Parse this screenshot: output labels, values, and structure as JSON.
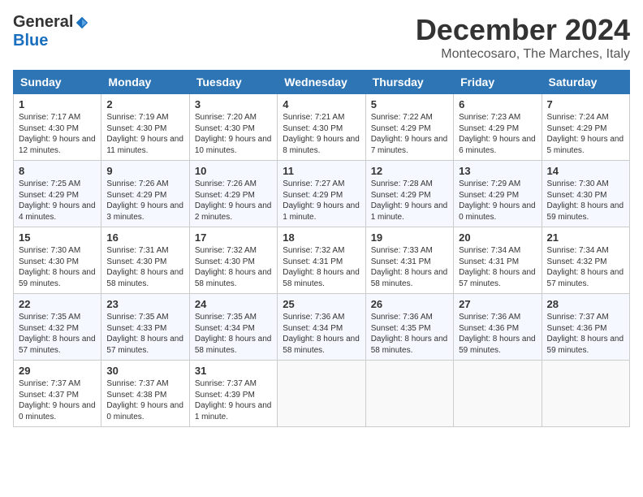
{
  "logo": {
    "general": "General",
    "blue": "Blue"
  },
  "title": "December 2024",
  "subtitle": "Montecosaro, The Marches, Italy",
  "days_of_week": [
    "Sunday",
    "Monday",
    "Tuesday",
    "Wednesday",
    "Thursday",
    "Friday",
    "Saturday"
  ],
  "weeks": [
    [
      {
        "day": "1",
        "info": "Sunrise: 7:17 AM\nSunset: 4:30 PM\nDaylight: 9 hours and 12 minutes."
      },
      {
        "day": "2",
        "info": "Sunrise: 7:19 AM\nSunset: 4:30 PM\nDaylight: 9 hours and 11 minutes."
      },
      {
        "day": "3",
        "info": "Sunrise: 7:20 AM\nSunset: 4:30 PM\nDaylight: 9 hours and 10 minutes."
      },
      {
        "day": "4",
        "info": "Sunrise: 7:21 AM\nSunset: 4:30 PM\nDaylight: 9 hours and 8 minutes."
      },
      {
        "day": "5",
        "info": "Sunrise: 7:22 AM\nSunset: 4:29 PM\nDaylight: 9 hours and 7 minutes."
      },
      {
        "day": "6",
        "info": "Sunrise: 7:23 AM\nSunset: 4:29 PM\nDaylight: 9 hours and 6 minutes."
      },
      {
        "day": "7",
        "info": "Sunrise: 7:24 AM\nSunset: 4:29 PM\nDaylight: 9 hours and 5 minutes."
      }
    ],
    [
      {
        "day": "8",
        "info": "Sunrise: 7:25 AM\nSunset: 4:29 PM\nDaylight: 9 hours and 4 minutes."
      },
      {
        "day": "9",
        "info": "Sunrise: 7:26 AM\nSunset: 4:29 PM\nDaylight: 9 hours and 3 minutes."
      },
      {
        "day": "10",
        "info": "Sunrise: 7:26 AM\nSunset: 4:29 PM\nDaylight: 9 hours and 2 minutes."
      },
      {
        "day": "11",
        "info": "Sunrise: 7:27 AM\nSunset: 4:29 PM\nDaylight: 9 hours and 1 minute."
      },
      {
        "day": "12",
        "info": "Sunrise: 7:28 AM\nSunset: 4:29 PM\nDaylight: 9 hours and 1 minute."
      },
      {
        "day": "13",
        "info": "Sunrise: 7:29 AM\nSunset: 4:29 PM\nDaylight: 9 hours and 0 minutes."
      },
      {
        "day": "14",
        "info": "Sunrise: 7:30 AM\nSunset: 4:30 PM\nDaylight: 8 hours and 59 minutes."
      }
    ],
    [
      {
        "day": "15",
        "info": "Sunrise: 7:30 AM\nSunset: 4:30 PM\nDaylight: 8 hours and 59 minutes."
      },
      {
        "day": "16",
        "info": "Sunrise: 7:31 AM\nSunset: 4:30 PM\nDaylight: 8 hours and 58 minutes."
      },
      {
        "day": "17",
        "info": "Sunrise: 7:32 AM\nSunset: 4:30 PM\nDaylight: 8 hours and 58 minutes."
      },
      {
        "day": "18",
        "info": "Sunrise: 7:32 AM\nSunset: 4:31 PM\nDaylight: 8 hours and 58 minutes."
      },
      {
        "day": "19",
        "info": "Sunrise: 7:33 AM\nSunset: 4:31 PM\nDaylight: 8 hours and 58 minutes."
      },
      {
        "day": "20",
        "info": "Sunrise: 7:34 AM\nSunset: 4:31 PM\nDaylight: 8 hours and 57 minutes."
      },
      {
        "day": "21",
        "info": "Sunrise: 7:34 AM\nSunset: 4:32 PM\nDaylight: 8 hours and 57 minutes."
      }
    ],
    [
      {
        "day": "22",
        "info": "Sunrise: 7:35 AM\nSunset: 4:32 PM\nDaylight: 8 hours and 57 minutes."
      },
      {
        "day": "23",
        "info": "Sunrise: 7:35 AM\nSunset: 4:33 PM\nDaylight: 8 hours and 57 minutes."
      },
      {
        "day": "24",
        "info": "Sunrise: 7:35 AM\nSunset: 4:34 PM\nDaylight: 8 hours and 58 minutes."
      },
      {
        "day": "25",
        "info": "Sunrise: 7:36 AM\nSunset: 4:34 PM\nDaylight: 8 hours and 58 minutes."
      },
      {
        "day": "26",
        "info": "Sunrise: 7:36 AM\nSunset: 4:35 PM\nDaylight: 8 hours and 58 minutes."
      },
      {
        "day": "27",
        "info": "Sunrise: 7:36 AM\nSunset: 4:36 PM\nDaylight: 8 hours and 59 minutes."
      },
      {
        "day": "28",
        "info": "Sunrise: 7:37 AM\nSunset: 4:36 PM\nDaylight: 8 hours and 59 minutes."
      }
    ],
    [
      {
        "day": "29",
        "info": "Sunrise: 7:37 AM\nSunset: 4:37 PM\nDaylight: 9 hours and 0 minutes."
      },
      {
        "day": "30",
        "info": "Sunrise: 7:37 AM\nSunset: 4:38 PM\nDaylight: 9 hours and 0 minutes."
      },
      {
        "day": "31",
        "info": "Sunrise: 7:37 AM\nSunset: 4:39 PM\nDaylight: 9 hours and 1 minute."
      },
      null,
      null,
      null,
      null
    ]
  ]
}
